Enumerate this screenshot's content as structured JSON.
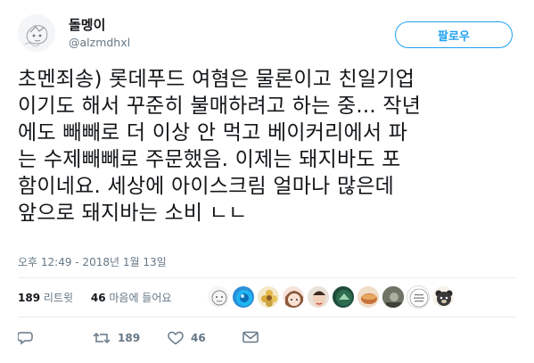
{
  "user": {
    "display_name": "돌멩이",
    "handle": "@alzmdhxl",
    "avatar_icon": "sketch-avatar"
  },
  "follow_button": {
    "label": "팔로우"
  },
  "tweet": {
    "text": "초멘죄송) 롯데푸드 여혐은 물론이고 친일기업\n이기도 해서 꾸준히 불매하려고 하는 중... 작년\n에도 빼빼로 더 이상 안 먹고 베이커리에서 파\n는 수제빼빼로 주문했음. 이제는 돼지바도 포\n함이네요. 세상에 아이스크림 얼마나 많은데\n앞으로 돼지바는 소비 ㄴㄴ",
    "timestamp": "오후 12:49 - 2018년 1월 13일"
  },
  "stats": {
    "retweets_count": "189",
    "retweets_label": "리트윗",
    "likes_count": "46",
    "likes_label": "마음에 들어요"
  },
  "likers": [
    "liker-sketch",
    "liker-blue-circle",
    "liker-flower",
    "liker-anime",
    "liker-face",
    "liker-dark-green",
    "liker-bowl",
    "liker-dark-photo",
    "liker-text-round",
    "liker-bear"
  ],
  "actions": {
    "reply_icon": "reply-icon",
    "retweet_icon": "retweet-icon",
    "retweet_count": "189",
    "like_icon": "heart-icon",
    "like_count": "46",
    "dm_icon": "envelope-icon"
  },
  "colors": {
    "accent": "#1da1f2",
    "muted": "#657786",
    "text": "#14171a",
    "divider": "#e6ecf0"
  }
}
